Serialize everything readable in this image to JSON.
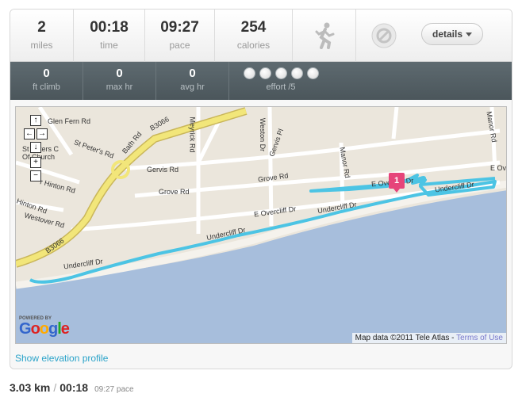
{
  "stats": {
    "distance": {
      "value": "2",
      "label": "miles"
    },
    "time": {
      "value": "00:18",
      "label": "time"
    },
    "pace": {
      "value": "09:27",
      "label": "pace"
    },
    "calories": {
      "value": "254",
      "label": "calories"
    },
    "activity_icon": "running-person-icon",
    "no_entry_icon": "prohibited-icon",
    "details_label": "details"
  },
  "secondary_stats": {
    "ft_climb": {
      "value": "0",
      "label": "ft climb"
    },
    "max_hr": {
      "value": "0",
      "label": "max hr"
    },
    "avg_hr": {
      "value": "0",
      "label": "avg hr"
    },
    "effort": {
      "label": "effort /5",
      "dots": 5
    }
  },
  "map": {
    "controls": [
      "↑",
      "←",
      "→",
      "↓",
      "+",
      "−"
    ],
    "road_labels": {
      "glen_fern": "Glen Fern Rd",
      "bath_rd": "Bath Rd",
      "b3066_top": "B3066",
      "b3066_bottom": "B3066",
      "st_peters": "St Peter's Rd",
      "st_peters_church": "St Peters C",
      "church": "Of Church",
      "hinton": "r Hinton Rd",
      "hinton_rd": "Hinton Rd",
      "westover": "Westover Rd",
      "meyrick": "Meyrick Rd",
      "gervis": "Gervis Rd",
      "gervis_pl": "Gervis Pl",
      "weston": "Weston Dr",
      "grove_1": "Grove Rd",
      "grove_2": "Grove Rd",
      "manor_rd": "Manor Rd",
      "manor_top": "Manor Rd",
      "e_overcliff": "E Overcliff Dr",
      "e_overcliff_2": "E Overcliff Dr",
      "e_ov": "E Ove",
      "undercliff_1": "Undercliff Dr",
      "undercliff_2": "Undercliff Dr",
      "undercliff_3": "Undercliff Dr",
      "undercliff_4": "Undercliff Dr"
    },
    "marker_label": "1",
    "powered_by": "POWERED BY",
    "google": "Google",
    "attribution": "Map data ©2011 Tele Atlas - ",
    "terms": "Terms of Use",
    "colors": {
      "route": "#4cc4e4",
      "sea": "#a7bedc",
      "land": "#ebe6dc",
      "major_road": "#f2e67a",
      "marker": "#e6447a"
    }
  },
  "elevation_link": "Show elevation profile",
  "summary": {
    "distance": "3.03 km",
    "separator": "/",
    "time": "00:18",
    "pace": "09:27 pace"
  }
}
